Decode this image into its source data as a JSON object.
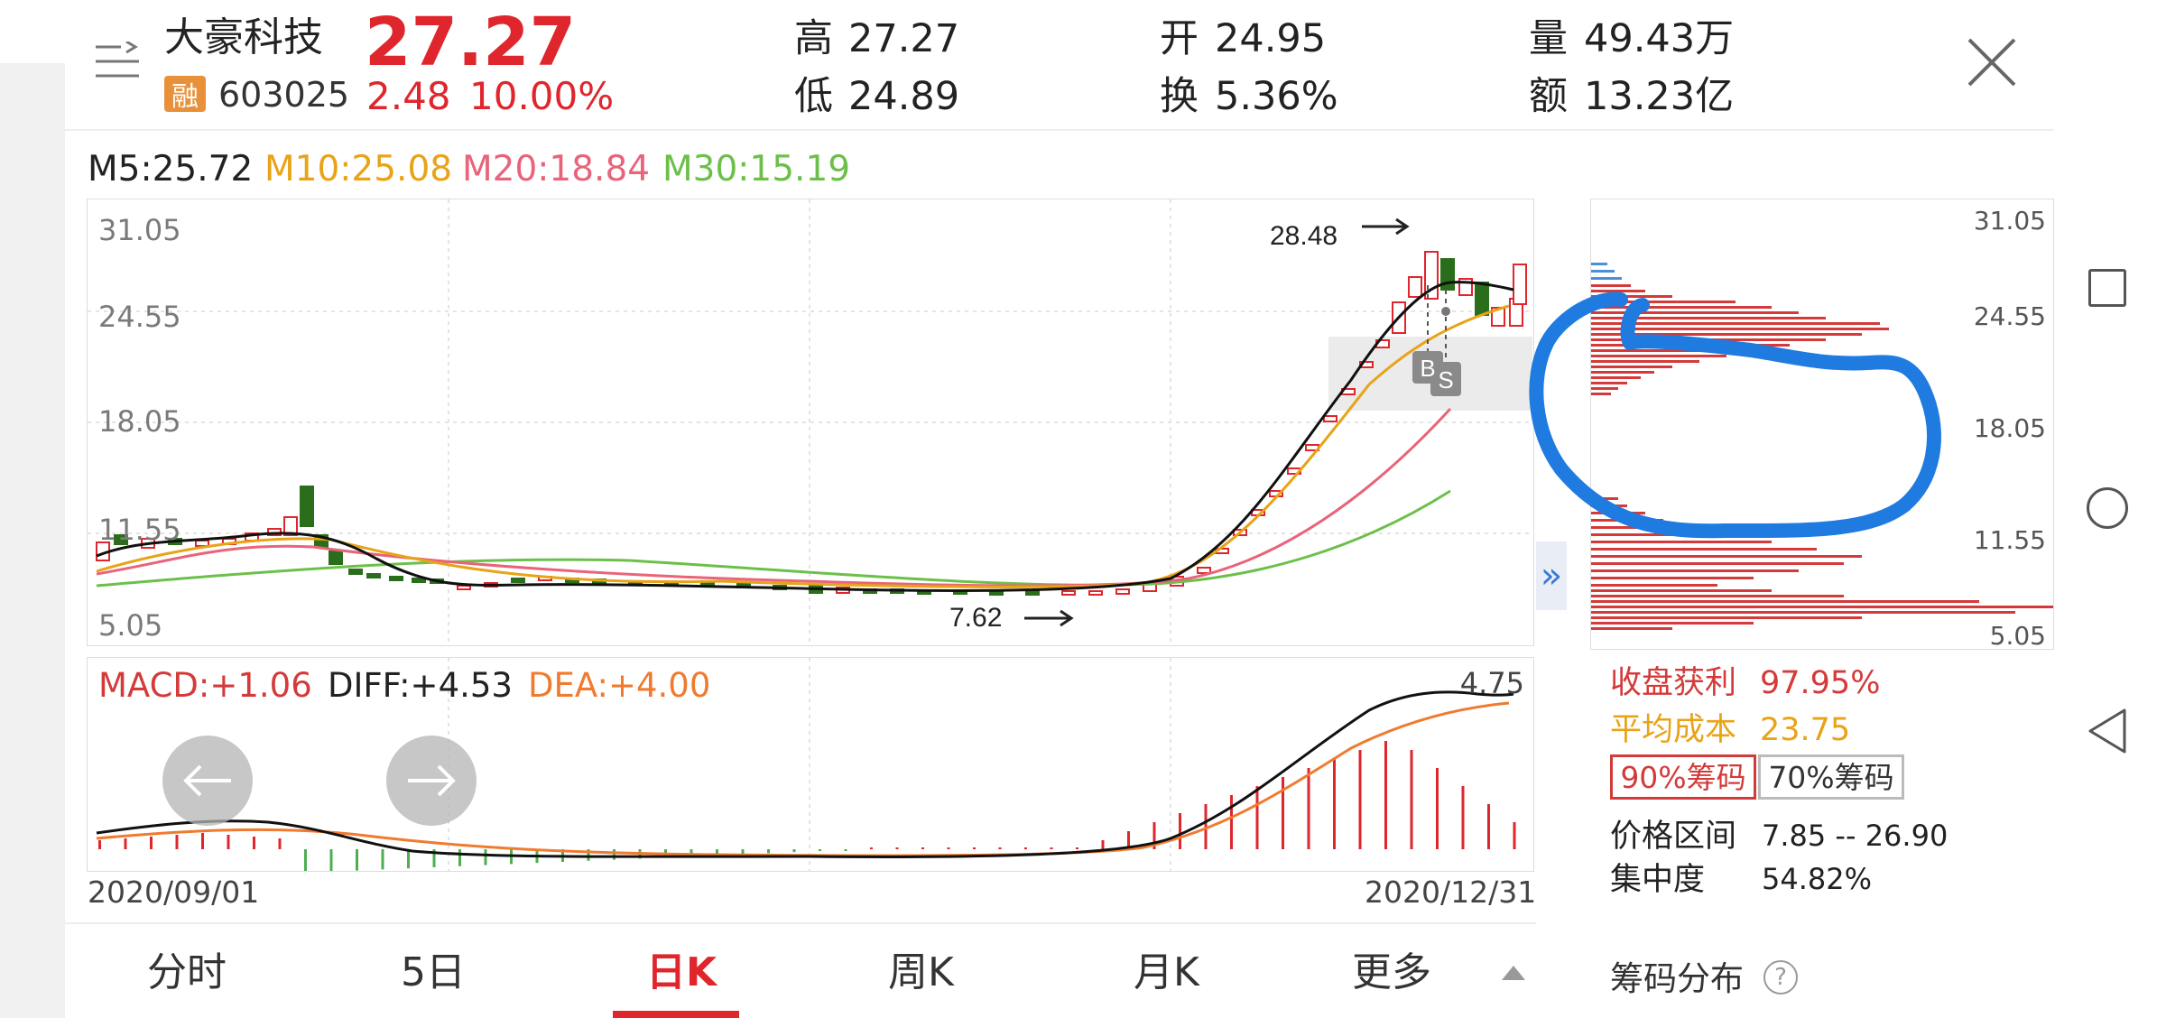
{
  "stock": {
    "name": "大豪科技",
    "code": "603025",
    "badge": "融",
    "price": "27.27",
    "change": "2.48",
    "change_pct": "10.00%",
    "high_label": "高",
    "high": "27.27",
    "low_label": "低",
    "low": "24.89",
    "open_label": "开",
    "open": "24.95",
    "turnover_label": "换",
    "turnover": "5.36%",
    "volume_label": "量",
    "volume": "49.43万",
    "amount_label": "额",
    "amount": "13.23亿"
  },
  "ma": {
    "m5": "M5:25.72",
    "m10": "M10:25.08",
    "m20": "M20:18.84",
    "m30": "M30:15.19"
  },
  "kchart": {
    "y_ticks": [
      "31.05",
      "24.55",
      "18.05",
      "11.55",
      "5.05"
    ],
    "high_annot": "28.48",
    "low_annot": "7.62",
    "marker_b": "B",
    "marker_s": "S"
  },
  "chips": {
    "y_ticks": [
      "31.05",
      "24.55",
      "18.05",
      "11.55",
      "5.05"
    ],
    "profit_label": "收盘获利",
    "profit_value": "97.95%",
    "avgcost_label": "平均成本",
    "avgcost_value": "23.75",
    "btn_90": "90%筹码",
    "btn_70": "70%筹码",
    "range_label": "价格区间",
    "range_value": "7.85 -- 26.90",
    "concentration_label": "集中度",
    "concentration_value": "54.82%",
    "dist_label": "筹码分布",
    "help_glyph": "?"
  },
  "macd": {
    "macd": "MACD:+1.06",
    "diff": "DIFF:+4.53",
    "dea": "DEA:+4.00",
    "max": "4.75",
    "date_start": "2020/09/01",
    "date_end": "2020/12/31"
  },
  "tabs": [
    {
      "label": "分时"
    },
    {
      "label": "5日"
    },
    {
      "label": "日K"
    },
    {
      "label": "周K"
    },
    {
      "label": "月K"
    },
    {
      "label": "更多"
    }
  ],
  "expand_glyph": "»",
  "colors": {
    "up": "#e0262d",
    "down": "#2a6e1b",
    "m5": "#222222",
    "m10": "#e8a317",
    "m20": "#e8647a",
    "m30": "#6cc04a",
    "dea": "#f07b2f",
    "annotation_blue": "#1f7be0"
  }
}
